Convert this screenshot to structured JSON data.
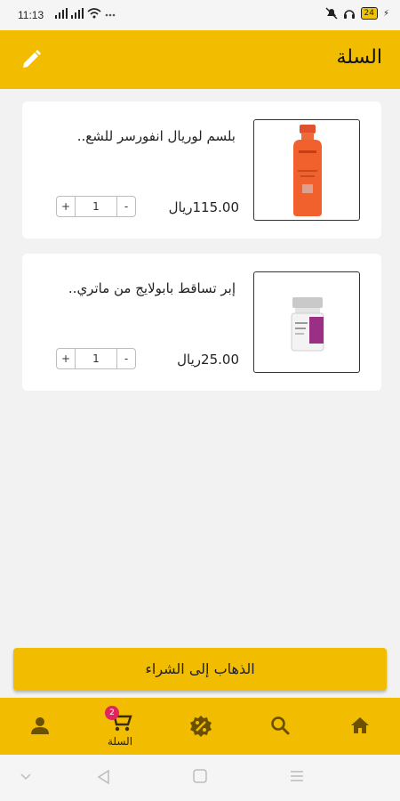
{
  "status_bar": {
    "time": "11:13",
    "battery": "24"
  },
  "app_bar": {
    "title": "السلة",
    "edit_icon": "pencil-icon"
  },
  "cart_items": [
    {
      "name": "بلسم لوريال انفورسر للشع..",
      "price": "115.00ريال",
      "quantity": "1",
      "minus": "-",
      "plus": "+"
    },
    {
      "name": "إبر تساقط بابولايج من ماتري..",
      "price": "25.00ريال",
      "quantity": "1",
      "minus": "-",
      "plus": "+"
    }
  ],
  "checkout_label": "الذهاب إلى الشراء",
  "bottom_nav": {
    "cart_label": "السلة",
    "cart_count": "2",
    "icons": [
      "home-icon",
      "search-icon",
      "badge-percent-icon",
      "cart-icon",
      "person-icon"
    ]
  },
  "colors": {
    "accent": "#f2bd00",
    "badge": "#e0245e"
  }
}
